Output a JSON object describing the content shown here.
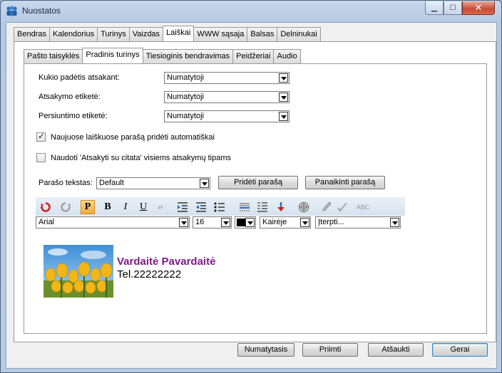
{
  "window": {
    "title": "Nuostatos"
  },
  "main_tabs": [
    "Bendras",
    "Kalendorius",
    "Turinys",
    "Vaizdas",
    "Laiškai",
    "WWW sąsaja",
    "Balsas",
    "Delninukai"
  ],
  "sub_tabs": [
    "Pašto taisyklės",
    "Pradinis turinys",
    "Tiesioginis bendravimas",
    "Peidžeriai",
    "Audio"
  ],
  "form": {
    "reply_position_label": "Kukio padėtis atsakant:",
    "reply_position_value": "Numatytoji",
    "reply_label_label": "Atsakymo etiketė:",
    "reply_label_value": "Numatytoji",
    "forward_label_label": "Persiuntimo etiketė:",
    "forward_label_value": "Numatytoji",
    "auto_signature_label": "Naujuose laiškuose parašą pridėti automatiškai",
    "auto_signature_checked": true,
    "quote_reply_label": "Naudoti 'Atsakyti su citata' visiems atsakymų tipams",
    "quote_reply_checked": false,
    "signature_text_label": "Parašo tekstas:",
    "signature_text_value": "Default",
    "add_signature_button": "Pridėti parašą",
    "remove_signature_button": "Panaikinti parašą"
  },
  "toolbar": {
    "font_value": "Arial",
    "size_value": "16",
    "color_value": "#000000",
    "align_value": "Kairėje",
    "insert_value": "Įterpti..."
  },
  "signature": {
    "name": "Vardaitė Pavardaitė",
    "phone": "Tel.22222222",
    "name_color": "#80188a",
    "image_icon": "tulips-photo"
  },
  "footer": {
    "defaults_button": "Numatytasis",
    "apply_button": "Priimti",
    "cancel_button": "Atšaukti",
    "ok_button": "Gerai"
  }
}
